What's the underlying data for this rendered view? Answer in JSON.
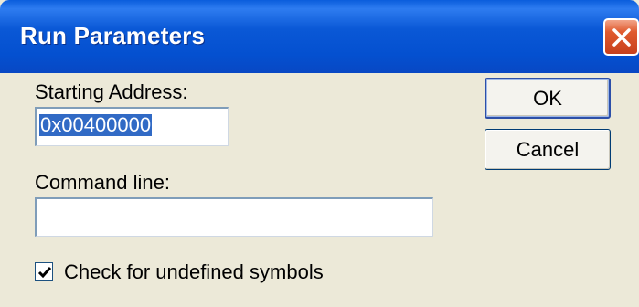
{
  "window": {
    "title": "Run Parameters"
  },
  "form": {
    "starting_address_label": "Starting Address:",
    "starting_address_value": "0x00400000",
    "command_line_label": "Command line:",
    "command_line_value": "",
    "check_symbols_label": "Check for undefined symbols",
    "check_symbols_checked": true
  },
  "buttons": {
    "ok_label": "OK",
    "cancel_label": "Cancel"
  },
  "icons": {
    "close": "close-icon",
    "check": "checkmark-icon"
  },
  "colors": {
    "titlebar": "#0a58d6",
    "selection": "#316ac5",
    "close_button": "#e05a2e",
    "dialog_bg": "#ece9d8"
  }
}
